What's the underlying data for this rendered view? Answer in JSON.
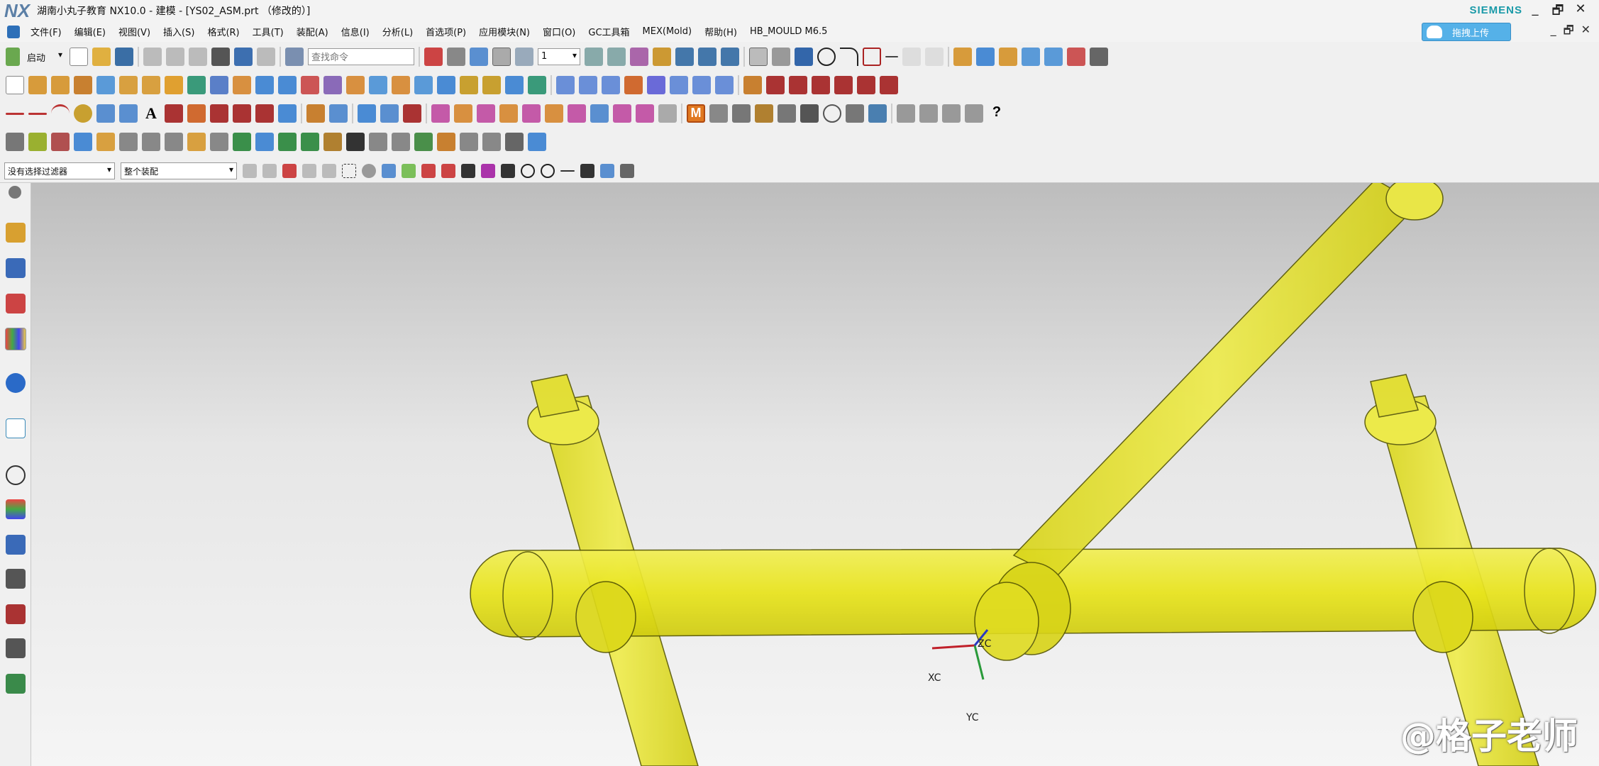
{
  "window": {
    "logo": "NX",
    "title": "湖南小丸子教育 NX10.0 - 建模 - [YS02_ASM.prt （修改的）]",
    "brand": "SIEMENS",
    "controls": [
      "_",
      "🗗",
      "✕"
    ]
  },
  "menu": {
    "items": [
      "文件(F)",
      "编辑(E)",
      "视图(V)",
      "插入(S)",
      "格式(R)",
      "工具(T)",
      "装配(A)",
      "信息(I)",
      "分析(L)",
      "首选项(P)",
      "应用模块(N)",
      "窗口(O)",
      "GC工具箱",
      "MEX(Mold)",
      "帮助(H)",
      "HB_MOULD M6.5"
    ],
    "cloud_label": "拖拽上传",
    "controls": [
      "_",
      "🗗",
      "✕"
    ]
  },
  "toolbar": {
    "start_label": "启动",
    "search_placeholder": "查找命令",
    "layer_value": "1"
  },
  "selection": {
    "filter_value": "没有选择过滤器",
    "scope_value": "整个装配"
  },
  "axes": {
    "zc": "ZC",
    "xc": "XC",
    "yc": "YC"
  },
  "watermark": "@格子老师",
  "colors": {
    "part": "#e8e41a",
    "part_edge": "#555500",
    "accent": "#1a9aa8"
  }
}
